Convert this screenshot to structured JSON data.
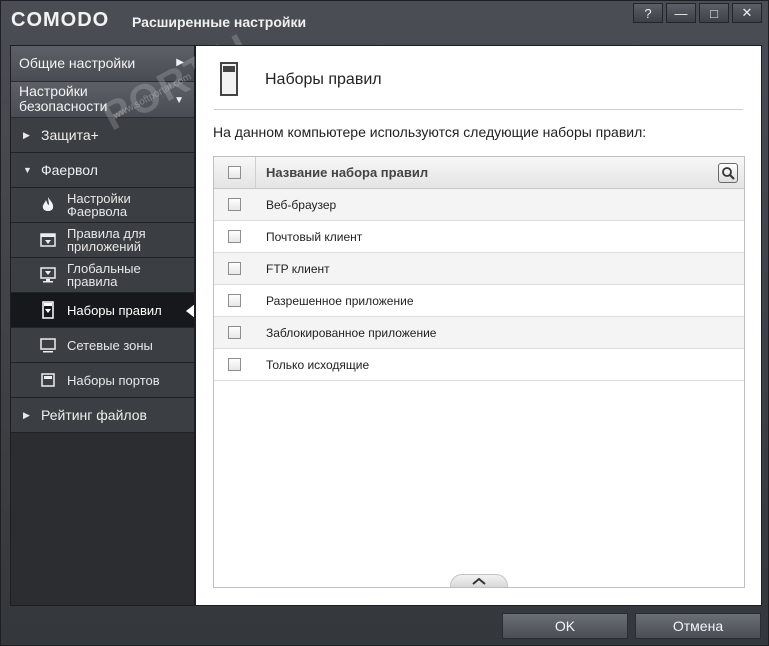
{
  "window": {
    "brand": "COMODO",
    "title": "Расширенные настройки",
    "buttons": {
      "help": "?",
      "minimize": "—",
      "maximize": "□",
      "close": "✕"
    }
  },
  "watermark": {
    "text": "PORTAL",
    "sub": "www.softportal.com"
  },
  "sidebar": {
    "top_items": [
      {
        "label": "Общие настройки",
        "icon": "chevron-right-icon"
      },
      {
        "label_line1": "Настройки",
        "label_line2": "безопасности",
        "icon": "chevron-down-icon"
      }
    ],
    "sections": {
      "protection": {
        "label": "Защита+",
        "expanded": false
      },
      "firewall": {
        "label": "Фаервол",
        "expanded": true
      },
      "file_rating": {
        "label": "Рейтинг файлов",
        "expanded": false
      }
    },
    "firewall_items": [
      {
        "line1": "Настройки",
        "line2": "Фаервола",
        "icon": "flame-icon"
      },
      {
        "line1": "Правила для",
        "line2": "приложений",
        "icon": "app-rules-icon"
      },
      {
        "line1": "Глобальные",
        "line2": "правила",
        "icon": "global-rules-icon"
      },
      {
        "line1": "Наборы правил",
        "line2": "",
        "icon": "ruleset-icon",
        "active": true
      },
      {
        "line1": "Сетевые зоны",
        "line2": "",
        "icon": "monitor-icon"
      },
      {
        "line1": "Наборы портов",
        "line2": "",
        "icon": "port-icon"
      }
    ]
  },
  "main": {
    "title": "Наборы правил",
    "description": "На данном компьютере используются следующие наборы правил:",
    "table": {
      "header": "Название набора правил",
      "rows": [
        "Веб-браузер",
        "Почтовый клиент",
        "FTP клиент",
        "Разрешенное приложение",
        "Заблокированное приложение",
        "Только исходящие"
      ]
    }
  },
  "footer": {
    "ok": "OK",
    "cancel": "Отмена"
  }
}
